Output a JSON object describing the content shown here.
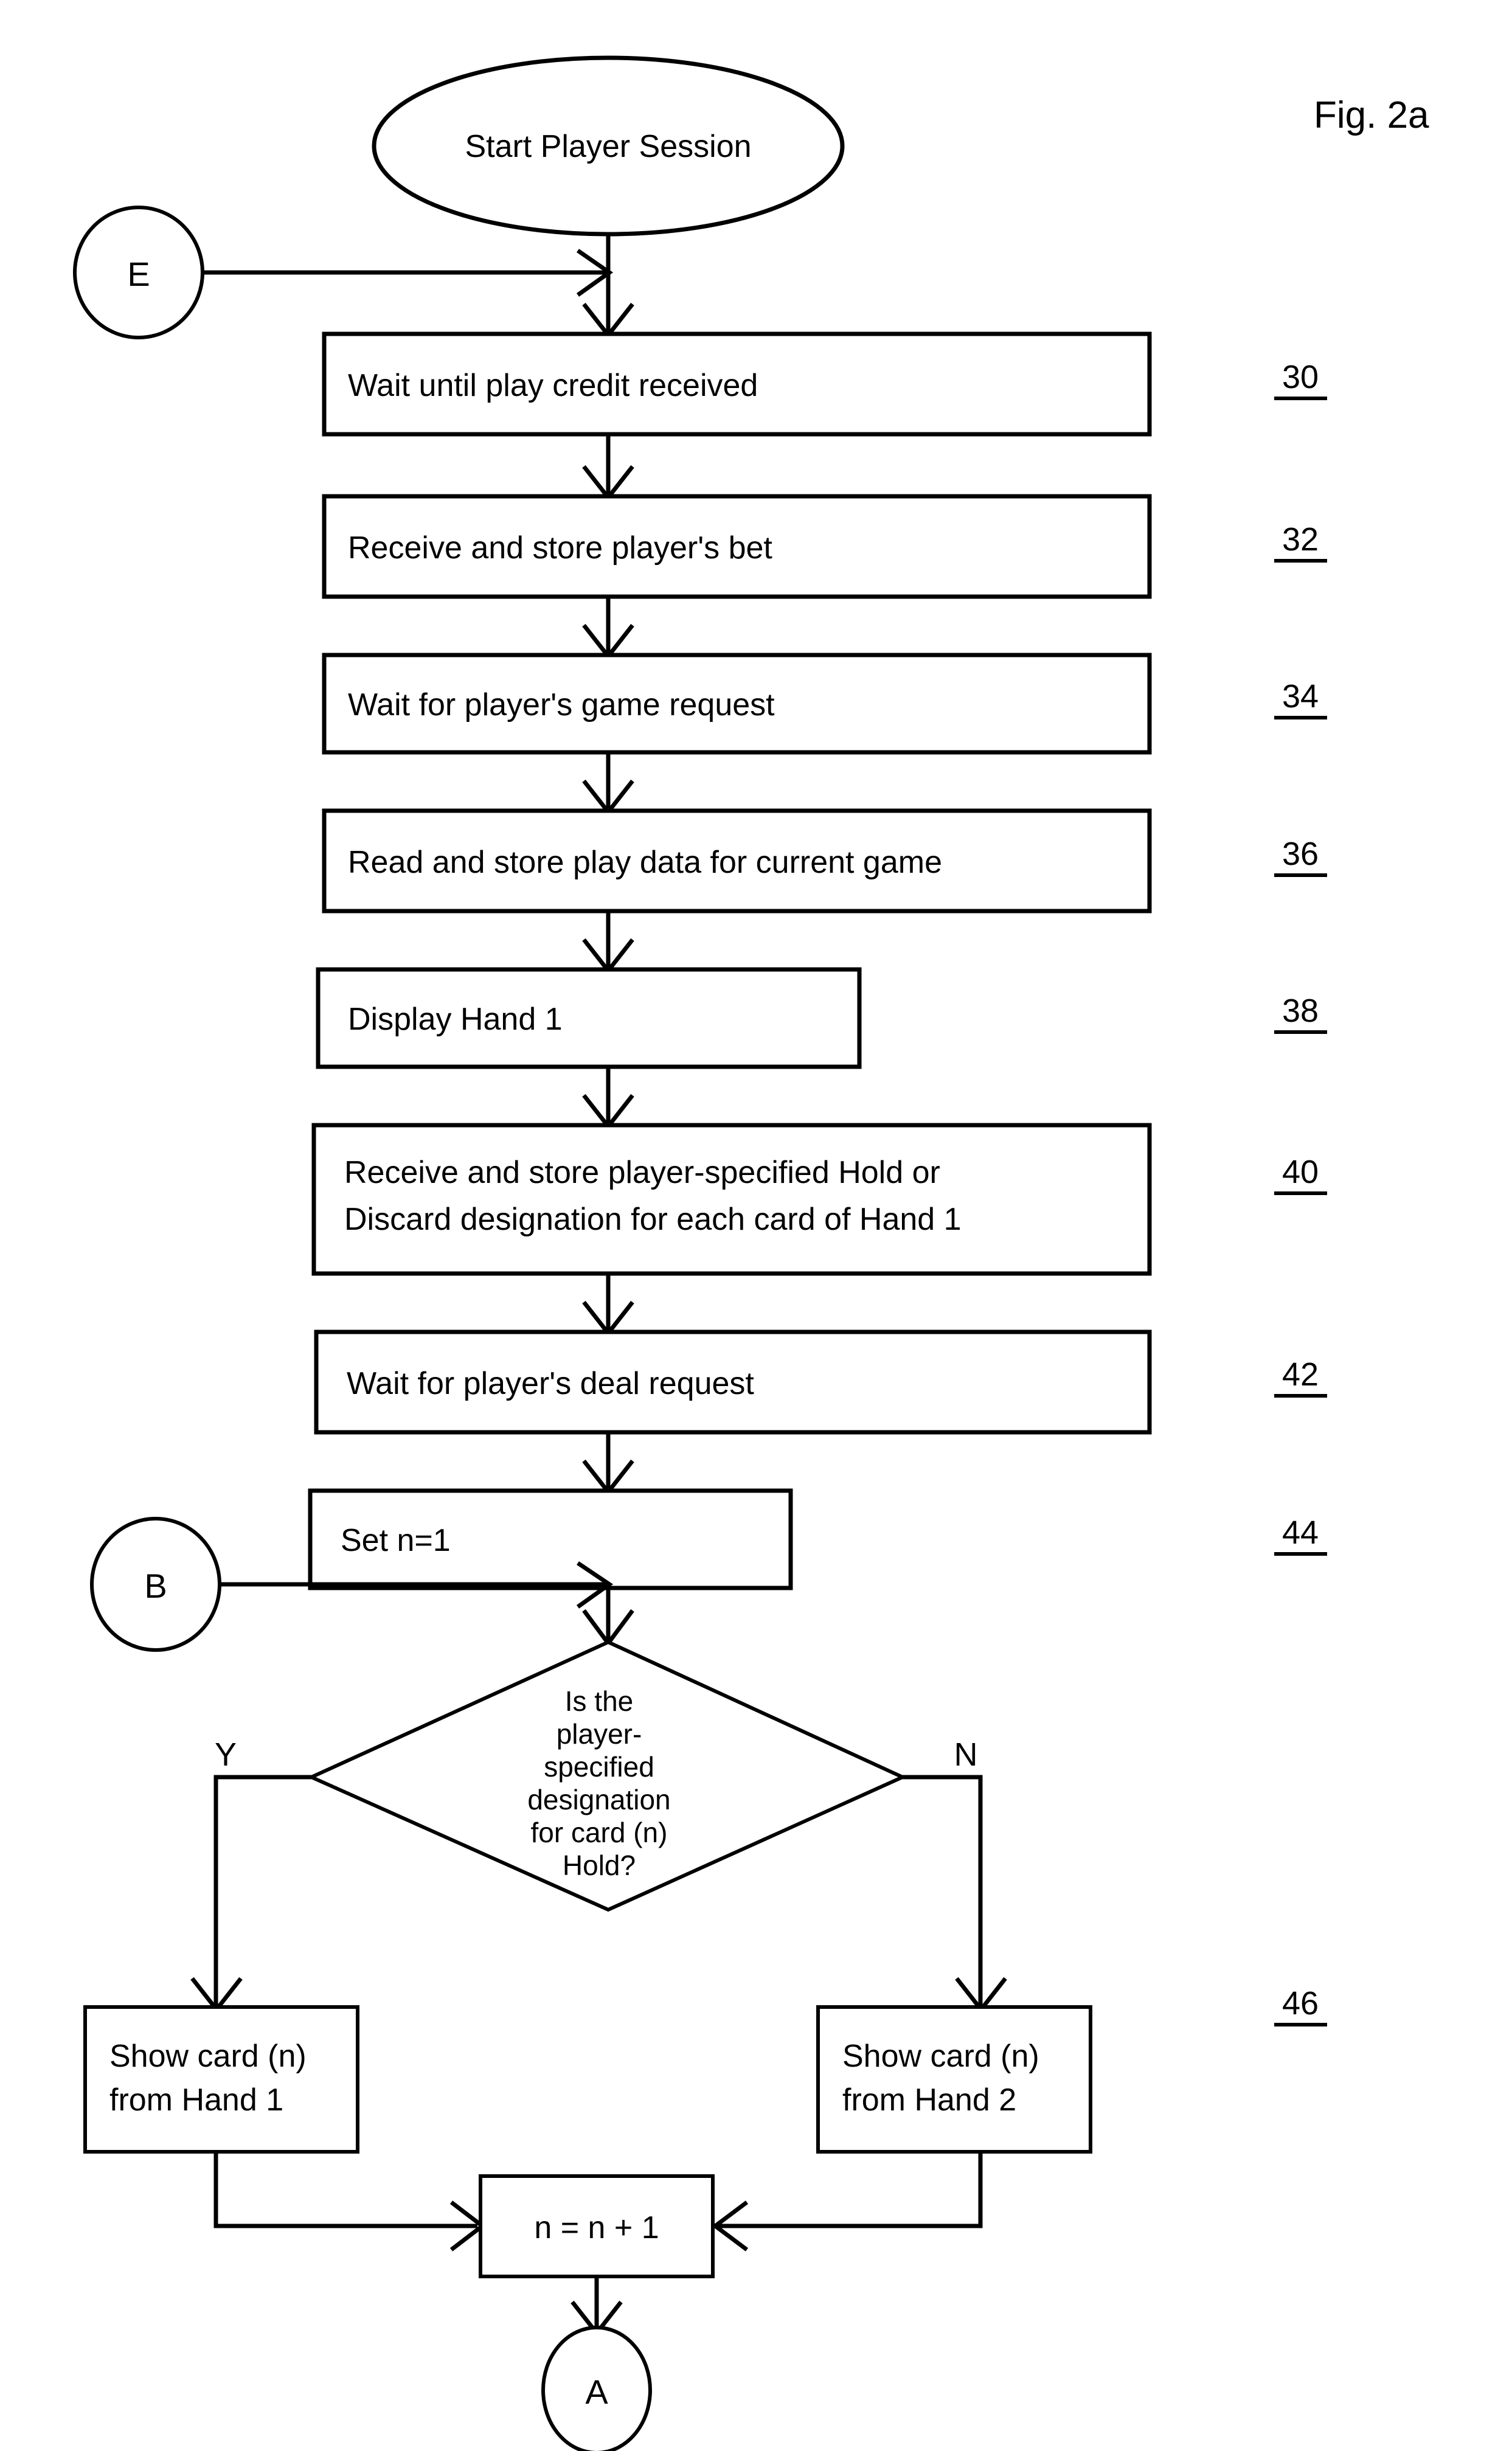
{
  "figure": {
    "title": "Fig. 2a"
  },
  "terminator": {
    "start_label": "Start Player Session"
  },
  "connectors": [
    {
      "id": "E",
      "label": "E"
    },
    {
      "id": "B",
      "label": "B"
    },
    {
      "id": "A",
      "label": "A"
    }
  ],
  "steps": [
    {
      "ref": "30",
      "label": "Wait until play credit received"
    },
    {
      "ref": "32",
      "label": "Receive and store player's bet"
    },
    {
      "ref": "34",
      "label": "Wait for player's game request"
    },
    {
      "ref": "36",
      "label": "Read and store play data for current game"
    },
    {
      "ref": "38",
      "label": "Display Hand 1"
    },
    {
      "ref": "40",
      "label_line1": "Receive and store player-specified Hold or",
      "label_line2": "Discard designation for each card of Hand 1"
    },
    {
      "ref": "42",
      "label": "Wait for player's deal request"
    },
    {
      "ref": "44",
      "label": "Set n=1"
    }
  ],
  "decision": {
    "ref": "46",
    "lines": [
      "Is the",
      "player-",
      "specified",
      "designation",
      "for card (n)",
      "Hold?"
    ],
    "yes_label": "Y",
    "no_label": "N"
  },
  "branches": {
    "yes_box_line1": "Show card (n)",
    "yes_box_line2": "from Hand 1",
    "no_box_line1": "Show card (n)",
    "no_box_line2": "from Hand 2"
  },
  "increment": {
    "label": "n = n + 1"
  },
  "colors": {
    "ink": "#000000",
    "paper": "#ffffff"
  }
}
